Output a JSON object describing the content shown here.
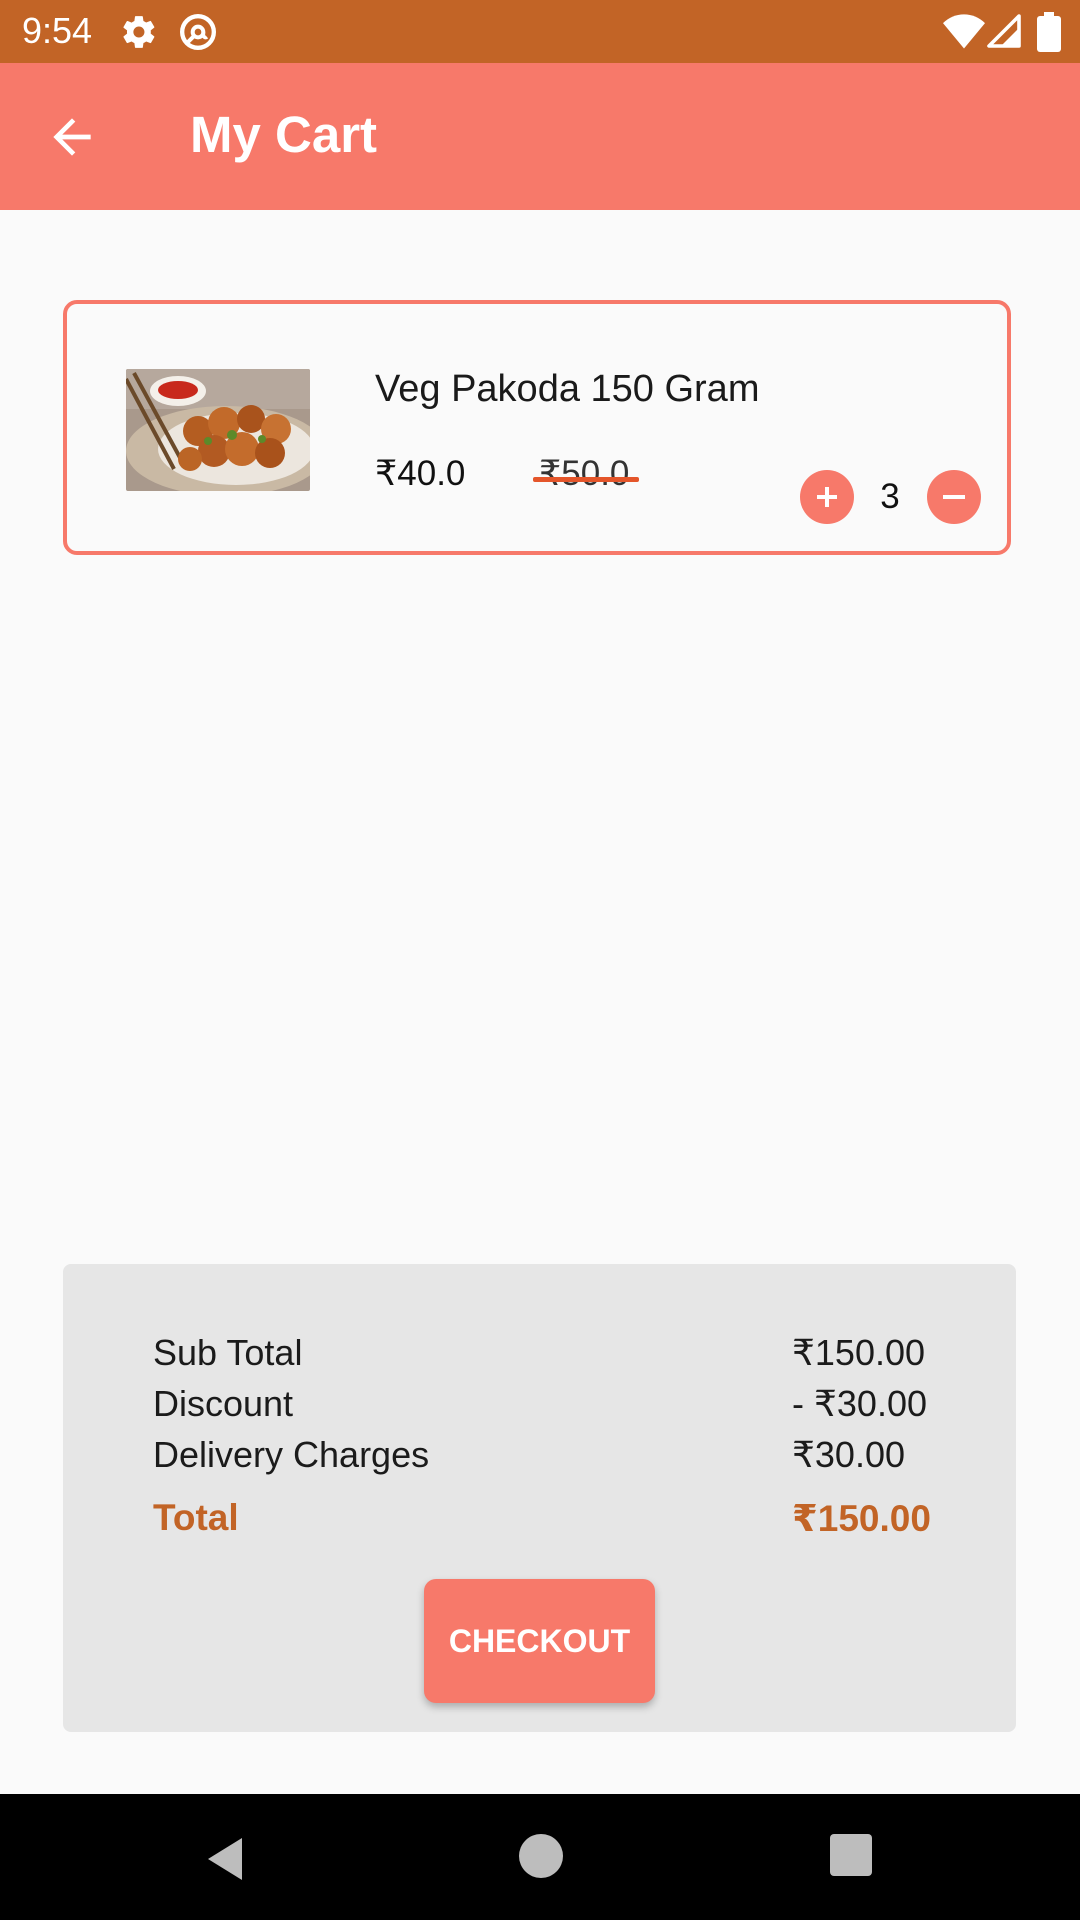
{
  "status_bar": {
    "time": "9:54",
    "icons": [
      "gear-icon",
      "at-sign-icon",
      "wifi-icon",
      "signal-icon",
      "battery-icon"
    ]
  },
  "app_bar": {
    "title": "My Cart",
    "back_icon": "arrow-left-icon",
    "color": "#f7796a"
  },
  "cart": {
    "items": [
      {
        "name": "Veg Pakoda 150 Gram",
        "price": "₹40.0",
        "original_price": "₹50.0",
        "quantity": "3",
        "image_icon": "food-image"
      }
    ]
  },
  "summary": {
    "sub_total_label": "Sub Total",
    "sub_total_value": "₹150.00",
    "discount_label": "Discount",
    "discount_value": "- ₹30.00",
    "delivery_label": "Delivery Charges",
    "delivery_value": "₹30.00",
    "total_label": "Total",
    "total_value": "₹150.00",
    "checkout_label": "CHECKOUT",
    "accent_color": "#c26426"
  },
  "nav_bar": {
    "icons": [
      "nav-back-icon",
      "nav-home-icon",
      "nav-recent-icon"
    ]
  }
}
